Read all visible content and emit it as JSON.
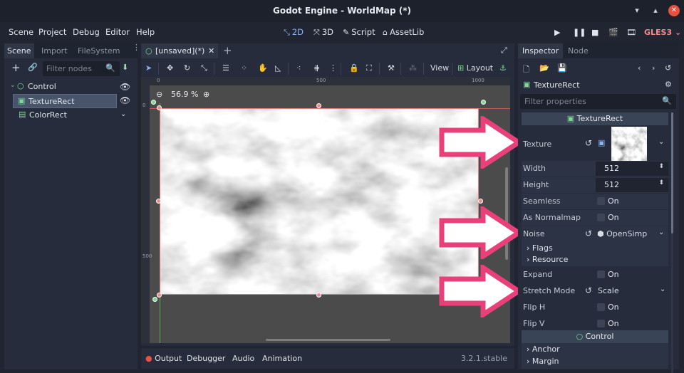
{
  "window": {
    "title": "Godot Engine - WorldMap (*)",
    "controls": [
      "▾",
      "▴",
      "✕"
    ]
  },
  "menubar": {
    "menus": [
      "Scene",
      "Project",
      "Debug",
      "Editor",
      "Help"
    ],
    "modes": [
      {
        "label": "2D",
        "icon": "2d-icon"
      },
      {
        "label": "3D",
        "icon": "3d-icon"
      },
      {
        "label": "Script",
        "icon": "script-icon"
      },
      {
        "label": "AssetLib",
        "icon": "assetlib-icon"
      }
    ],
    "renderer": "GLES3"
  },
  "scene_dock": {
    "tabs": [
      "Scene",
      "Import",
      "FileSystem"
    ],
    "filter_placeholder": "Filter nodes",
    "nodes": [
      {
        "label": "Control",
        "level": 0
      },
      {
        "label": "TextureRect",
        "level": 1,
        "selected": true
      },
      {
        "label": "ColorRect",
        "level": 1
      }
    ]
  },
  "editor": {
    "tab_label": "[unsaved](*)",
    "toolbar": {
      "view_label": "View",
      "layout_label": "Layout"
    },
    "zoom_label": "56.9 %",
    "ruler_top": [
      "0",
      "500",
      "1000"
    ],
    "ruler_left": [
      "0",
      "500"
    ]
  },
  "bottom_panel": {
    "tabs": [
      "Output",
      "Debugger",
      "Audio",
      "Animation"
    ],
    "version": "3.2.1.stable"
  },
  "inspector": {
    "tabs": [
      "Inspector",
      "Node"
    ],
    "object_name": "TextureRect",
    "filter_placeholder": "Filter properties",
    "texture_section": "TextureRect",
    "props": {
      "texture": "Texture",
      "width_label": "Width",
      "width": "512",
      "height_label": "Height",
      "height": "512",
      "seamless_label": "Seamless",
      "seamless_value": "On",
      "normalmap_label": "As Normalmap",
      "normalmap_value": "On",
      "noise_label": "Noise",
      "noise_value": "OpenSimp",
      "flags_label": "Flags",
      "resource_label": "Resource",
      "expand_label": "Expand",
      "expand_value": "On",
      "stretch_label": "Stretch Mode",
      "stretch_value": "Scale",
      "fliph_label": "Flip H",
      "fliph_value": "On",
      "flipv_label": "Flip V",
      "flipv_value": "On"
    },
    "control_section": "Control",
    "control_subs": [
      "Anchor",
      "Margin"
    ]
  },
  "colors": {
    "accent": "#8ab4f8",
    "annotation_arrow": "#e9407a",
    "selection_outline": "#e67d7d"
  }
}
